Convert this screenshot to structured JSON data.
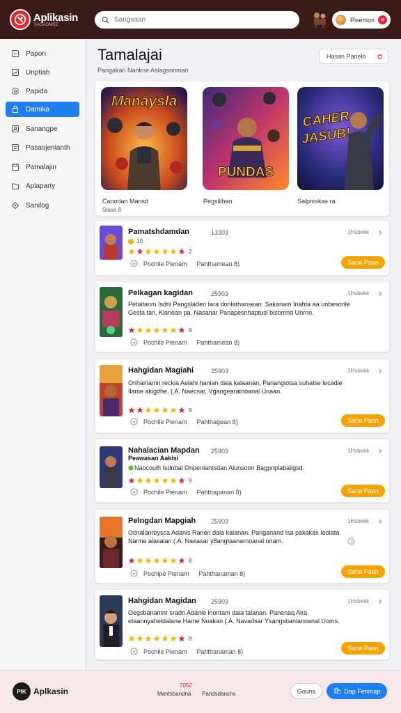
{
  "header": {
    "brand": "Aplikasin",
    "brand_sub": "SAGAOMEE",
    "search_placeholder": "Sangsaan",
    "account_label": "Pisemon"
  },
  "sidebar": {
    "items": [
      {
        "label": "Papon",
        "icon": "home-icon"
      },
      {
        "label": "Unptiah",
        "icon": "chart-icon"
      },
      {
        "label": "Papida",
        "icon": "lock-icon"
      },
      {
        "label": "Damika",
        "icon": "bag-icon",
        "active": true
      },
      {
        "label": "Sanangpe",
        "icon": "user-icon"
      },
      {
        "label": "Pasaojenlanth",
        "icon": "list-icon"
      },
      {
        "label": "Pamalajin",
        "icon": "calendar-icon"
      },
      {
        "label": "Aplaparty",
        "icon": "folder-icon"
      },
      {
        "label": "Sanilog",
        "icon": "tag-icon"
      }
    ]
  },
  "main": {
    "title": "Tamalajai",
    "subtitle": "Pangakan Nankne Aslagsonman",
    "sort_label": "Hasan Panelo"
  },
  "featured": [
    {
      "art_text": "Manaysla",
      "caption": "Canodan Mansd",
      "subcaption": "Stase 8"
    },
    {
      "art_text": "PUNDAS",
      "caption": "Pegsiliban"
    },
    {
      "art_text": "CAHER JASUB!",
      "caption": "Salpnnikas ra"
    }
  ],
  "apps": [
    {
      "title": "Pamatshdamdan",
      "count": "13303",
      "meta": "1Hsbekk",
      "tag": "10",
      "desc": "",
      "rating": "2",
      "foot1": "Pochile Pienam",
      "foot2": "Pahthamean 8)",
      "button": "Sana Paan"
    },
    {
      "title": "Pelkagan kagidan",
      "count": "25903",
      "meta": "1Hsbekk",
      "desc": "Petaitanm Isdnl Pangsladen fara donlathansean. Sakanam Inahta aa unbesonle Gesta tan, Klanean pa. Nasanar Panapesnhaptusl bisomnd Unrnn.",
      "rating": "9",
      "foot1": "Pochile Pienam",
      "foot2": "Pahthamean 8)",
      "button": ""
    },
    {
      "title": "Hahgidan Magiahi",
      "count": "25903",
      "meta": "1Hsbekk",
      "desc": "Onhainamn reckia Aelahi hanian dala kalaanan, Panangiotsa suhalse lecadie Ilame akigdhe. (.A. Naecsar, Vgangearatnoanal Unaan.",
      "rating": "9",
      "foot1": "Pochile Pienam",
      "foot2": "Pahthagean 8)",
      "button": "Sana Paan"
    },
    {
      "title": "Nahalacian Mapdan",
      "title2": "Peawasan Aakisi",
      "count": "25903",
      "meta": "1Hsbekk",
      "desc": "Naocoulh Isdnbal Onpenlantsdan Alunsoon Bagpnplabaligsd.",
      "rating": "9",
      "foot1": "Pochile Pienam",
      "foot2": "Pahthapanan 8)",
      "button": "Sana Paan"
    },
    {
      "title": "Pelngdan Mapgiah",
      "count": "25903",
      "meta": "1Hsbekk",
      "desc": "Ocnalanreysca Adanls Ranen dala kalanan. Panganand Isa pakakas Ieolata Nanne alasaian (.A. Naeasar y8angtaanarnoanal onam.",
      "rating": "8",
      "foot1": "Pochipe Pienam",
      "foot2": "Pahthanaman 8)",
      "button": "Sana Paan"
    },
    {
      "title": "Hahgidan Magidan",
      "count": "25903",
      "meta": "1Hsbekk",
      "desc": "Oegsbanamnr sradn Adanle lnontam dala talanan. Panenaq Alra etaannyaheldalane Hame Noakan (.A. Navadsar Ysangsbanianoanal Uoms.",
      "rating": "8",
      "foot1": "Pochile Pienam",
      "foot2": "Pahthanaman 8)",
      "button": "Sana Paan"
    }
  ],
  "footer": {
    "logo_text": "PIK",
    "brand": "Aplkasin",
    "year": "7052",
    "link1": "Mantsbandna",
    "link2": "Pandsdanchs",
    "cancel": "Gouns",
    "primary": "Dap Fenmap",
    "primary_icon": "shopping-icon"
  },
  "colors": {
    "topbar": "#3b1a1a",
    "accent_blue": "#1f7ef0",
    "button_orange": "#f5a300",
    "brand_red": "#e8262d",
    "star": "#f5b400"
  }
}
